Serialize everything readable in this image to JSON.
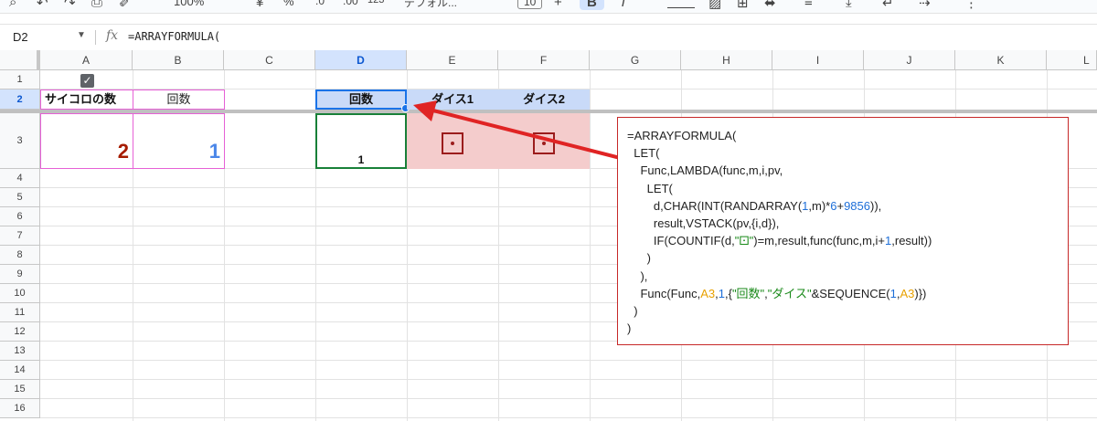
{
  "toolbar": {
    "zoom": "100%",
    "percent": "%",
    "decimal_dec": ".0",
    "decimal_inc": ".00",
    "number_format": "123",
    "font_name": "デフォル...",
    "font_size": "10",
    "plus": "+",
    "bold": "B",
    "more": "⋮"
  },
  "formula_bar": {
    "name_box": "D2",
    "fx": "fx",
    "formula": "=ARRAYFORMULA("
  },
  "columns": [
    "A",
    "B",
    "C",
    "D",
    "E",
    "F",
    "G",
    "H",
    "I",
    "J",
    "K",
    "L"
  ],
  "rows": [
    "1",
    "2",
    "3",
    "4",
    "5",
    "6",
    "7",
    "8",
    "9",
    "10",
    "11",
    "12",
    "13",
    "14",
    "15",
    "16"
  ],
  "cells": {
    "A2": "サイコロの数",
    "B2": "回数",
    "A3": "2",
    "B3": "1",
    "D2": "回数",
    "E2": "ダイス1",
    "F2": "ダイス2",
    "D3": "1"
  },
  "colors": {
    "header_fill": "#c9daf8",
    "dice_fill": "#f4cccc",
    "a3_text": "#a61c00",
    "b3_text": "#4a86e8",
    "annotation": "#c62828"
  },
  "formula_box": {
    "l1": "=ARRAYFORMULA(",
    "l2": "  LET(",
    "l3": "    Func,LAMBDA(func,m,i,pv,",
    "l4": "      LET(",
    "l5a": "        d,CHAR(INT(RANDARRAY(",
    "l5b": "1",
    "l5c": ",m)*",
    "l5d": "6",
    "l5e": "+",
    "l5f": "9856",
    "l5g": ")),",
    "l6": "        result,VSTACK(pv,{i,d}),",
    "l7a": "        IF(COUNTIF(d,",
    "l7b": "\"⚀\"",
    "l7c": ")=m,result,func(func,m,i+",
    "l7d": "1",
    "l7e": ",result))",
    "l8": "      )",
    "l9": "    ),",
    "l10a": "    Func(Func,",
    "l10b": "A3",
    "l10c": ",",
    "l10d": "1",
    "l10e": ",{",
    "l10f": "\"回数\"",
    "l10g": ",",
    "l10h": "\"ダイス\"",
    "l10i": "&SEQUENCE(",
    "l10j": "1",
    "l10k": ",",
    "l10l": "A3",
    "l10m": ")})",
    "l11": "  )",
    "l12": ")"
  }
}
